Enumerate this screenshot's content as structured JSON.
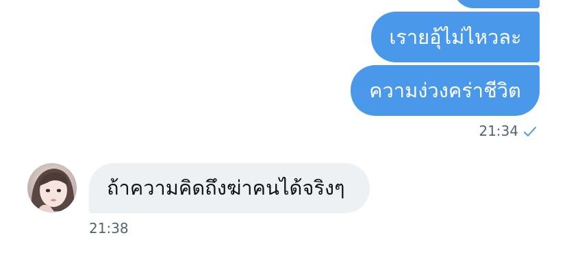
{
  "conversation": {
    "messages": [
      {
        "direction": "outgoing",
        "text": ""
      },
      {
        "direction": "outgoing",
        "text": "เรายอุ้ไม่ไหวละ"
      },
      {
        "direction": "outgoing",
        "text": "ความง่วงคร่าชีวิต",
        "time": "21:34",
        "status_icon": "check-icon"
      },
      {
        "direction": "incoming",
        "text": "ถ้าความคิดถึงฆ่าคนได้จริงๆ",
        "time": "21:38",
        "avatar": "avatar"
      }
    ]
  },
  "colors": {
    "outgoing_bubble": "#4a98e9",
    "incoming_bubble": "#eef1f4",
    "timestamp": "#536471",
    "read_check": "#4a98e9"
  }
}
